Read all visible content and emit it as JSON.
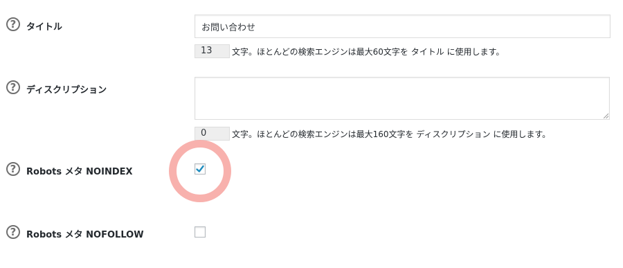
{
  "fields": {
    "title": {
      "label": "タイトル",
      "value": "お問い合わせ",
      "count": "13",
      "count_text": "文字。ほとんどの検索エンジンは最大60文字を タイトル に使用します。"
    },
    "description": {
      "label": "ディスクリプション",
      "value": "",
      "count": "0",
      "count_text": "文字。ほとんどの検索エンジンは最大160文字を ディスクリプション に使用します。"
    },
    "noindex": {
      "label": "Robots メタ NOINDEX",
      "checked": true
    },
    "nofollow": {
      "label": "Robots メタ NOFOLLOW",
      "checked": false
    }
  },
  "help_icon_glyph": "?",
  "colors": {
    "checkmark": "#1e8cbe",
    "highlight": "#f7a9a4",
    "icon": "#707070"
  }
}
